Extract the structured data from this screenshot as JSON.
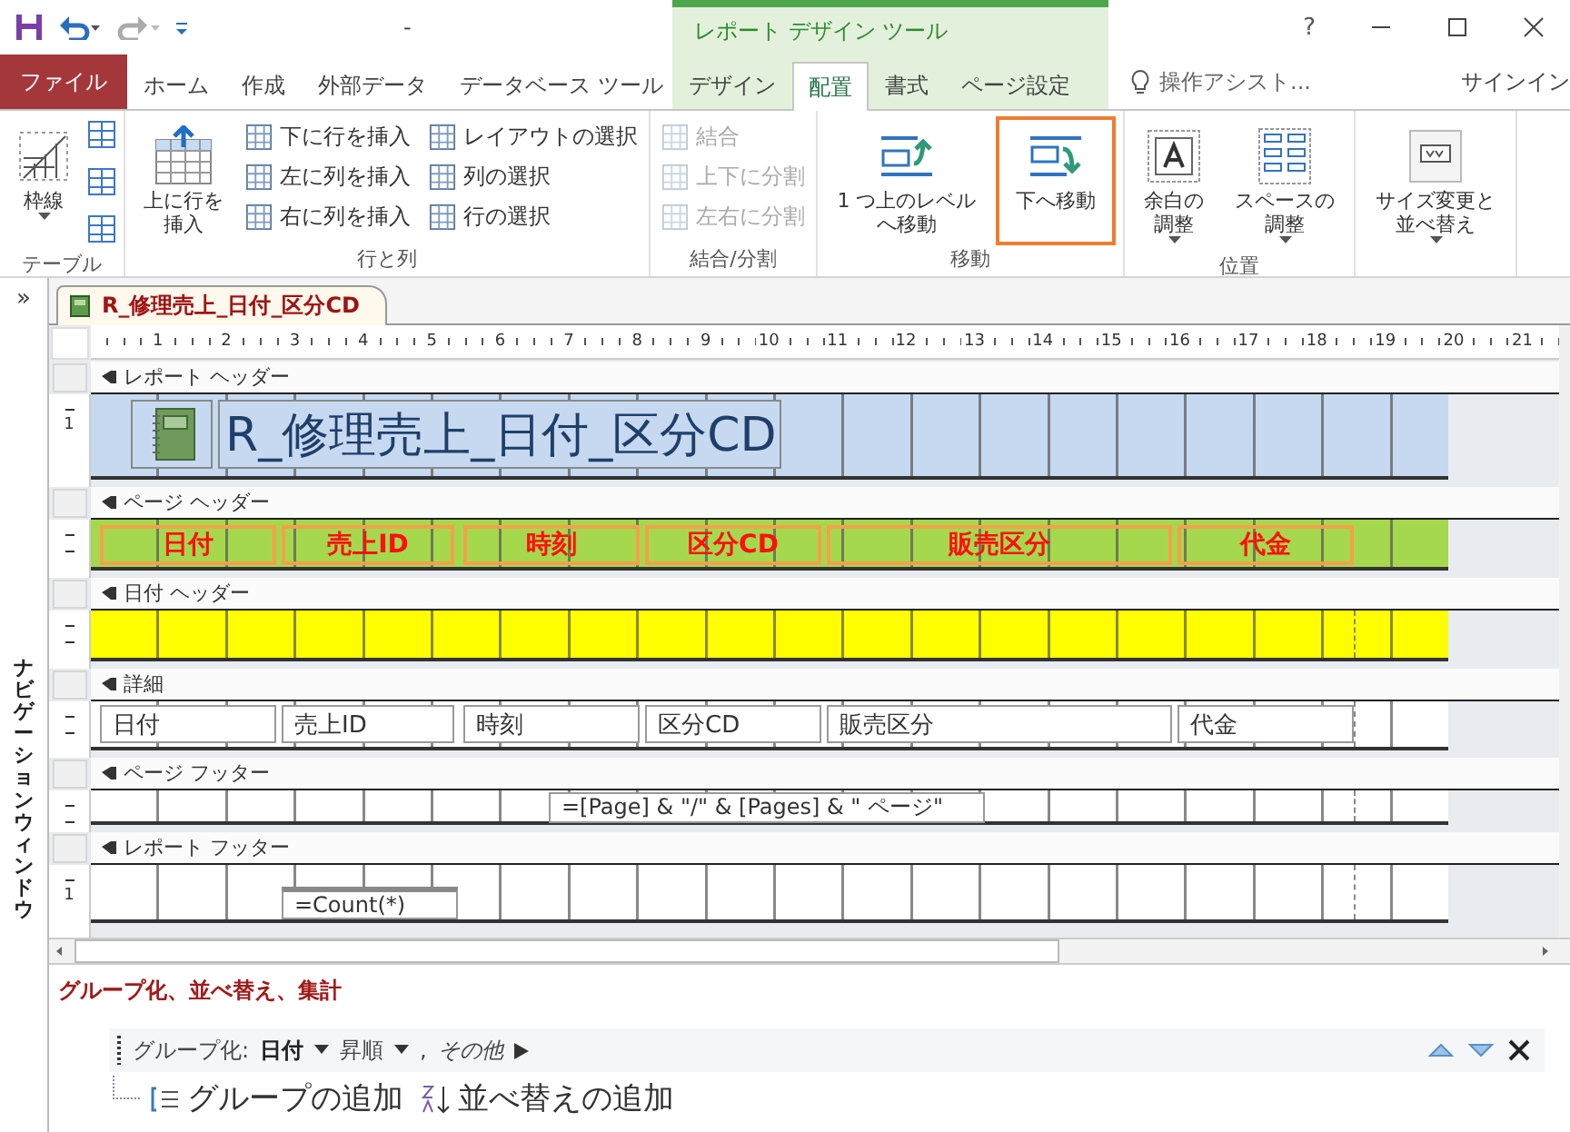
{
  "quick_access": {
    "title": "-"
  },
  "window": {
    "help": "?"
  },
  "context_title": "レポート デザイン ツール",
  "tabs": [
    {
      "label": "ファイル",
      "kind": "file",
      "contextual": false,
      "selected": false
    },
    {
      "label": "ホーム",
      "kind": "tab",
      "contextual": false,
      "selected": false
    },
    {
      "label": "作成",
      "kind": "tab",
      "contextual": false,
      "selected": false
    },
    {
      "label": "外部データ",
      "kind": "tab",
      "contextual": false,
      "selected": false
    },
    {
      "label": "データベース ツール",
      "kind": "tab",
      "contextual": false,
      "selected": false
    },
    {
      "label": "デザイン",
      "kind": "tab",
      "contextual": true,
      "selected": false
    },
    {
      "label": "配置",
      "kind": "tab",
      "contextual": true,
      "selected": true
    },
    {
      "label": "書式",
      "kind": "tab",
      "contextual": true,
      "selected": false
    },
    {
      "label": "ページ設定",
      "kind": "tab",
      "contextual": true,
      "selected": false
    }
  ],
  "tell_me": {
    "placeholder": "操作アシスト..."
  },
  "sign_in": "サインイン",
  "ribbon": {
    "groups": [
      {
        "label": "テーブル",
        "items": [
          {
            "kind": "large",
            "label": "枠線",
            "dropdown": true,
            "disabled": false,
            "highlighted": false
          },
          {
            "kind": "icon"
          },
          {
            "kind": "icon"
          },
          {
            "kind": "icon"
          }
        ]
      },
      {
        "label": "行と列",
        "items": [
          {
            "kind": "large",
            "label": "上に行を挿入",
            "dropdown": false,
            "disabled": false,
            "highlighted": false
          },
          {
            "kind": "small",
            "label": "下に行を挿入",
            "disabled": false
          },
          {
            "kind": "small",
            "label": "左に列を挿入",
            "disabled": false
          },
          {
            "kind": "small",
            "label": "右に列を挿入",
            "disabled": false
          },
          {
            "kind": "small",
            "label": "レイアウトの選択",
            "disabled": false
          },
          {
            "kind": "small",
            "label": "列の選択",
            "disabled": false
          },
          {
            "kind": "small",
            "label": "行の選択",
            "disabled": false
          }
        ]
      },
      {
        "label": "結合/分割",
        "items": [
          {
            "kind": "small",
            "label": "結合",
            "disabled": true
          },
          {
            "kind": "small",
            "label": "上下に分割",
            "disabled": true
          },
          {
            "kind": "small",
            "label": "左右に分割",
            "disabled": true
          }
        ]
      },
      {
        "label": "移動",
        "items": [
          {
            "kind": "large",
            "label": "1 つ上のレベルへ移動",
            "dropdown": false,
            "disabled": false,
            "highlighted": false
          },
          {
            "kind": "large",
            "label": "下へ移動",
            "dropdown": false,
            "disabled": false,
            "highlighted": true
          }
        ]
      },
      {
        "label": "位置",
        "items": [
          {
            "kind": "large",
            "label": "余白の調整",
            "dropdown": true,
            "disabled": false,
            "highlighted": false
          },
          {
            "kind": "large",
            "label": "スペースの調整",
            "dropdown": true,
            "disabled": false,
            "highlighted": false
          }
        ]
      },
      {
        "items": [
          {
            "kind": "large",
            "label": "サイズ変更と並べ替え",
            "dropdown": true,
            "disabled": false,
            "highlighted": false
          }
        ]
      }
    ]
  },
  "nav_pane": {
    "expand": "»",
    "title": "ナビゲーションウィンドウ"
  },
  "document_tab": {
    "title": "R_修理売上_日付_区分CD"
  },
  "ruler": [
    "1",
    "2",
    "3",
    "4",
    "5",
    "6",
    "7",
    "8",
    "9",
    "10",
    "11",
    "12",
    "13",
    "14",
    "15",
    "16",
    "17",
    "18",
    "19",
    "20",
    "21"
  ],
  "sections": [
    {
      "title": "レポート ヘッダー",
      "kind": "report-header",
      "color": "#c6d9f0",
      "ruler_label": "1",
      "controls": [
        {
          "kind": "logo"
        },
        {
          "kind": "title",
          "text": "R_修理売上_日付_区分CD"
        }
      ]
    },
    {
      "title": "ページ ヘッダー",
      "kind": "page-header",
      "color": "#a6d84e",
      "controls": [
        {
          "kind": "label",
          "text": "日付",
          "selected": true
        },
        {
          "kind": "label",
          "text": "売上ID",
          "selected": true
        },
        {
          "kind": "label",
          "text": "時刻",
          "selected": true
        },
        {
          "kind": "label",
          "text": "区分CD",
          "selected": true
        },
        {
          "kind": "label",
          "text": "販売区分",
          "selected": true
        },
        {
          "kind": "label",
          "text": "代金",
          "selected": true
        }
      ]
    },
    {
      "title": "日付 ヘッダー",
      "kind": "group-header",
      "color": "#ffff00"
    },
    {
      "title": "詳細",
      "kind": "detail",
      "color": "#ffffff",
      "controls": [
        {
          "kind": "textbox",
          "text": "日付"
        },
        {
          "kind": "textbox",
          "text": "売上ID"
        },
        {
          "kind": "textbox",
          "text": "時刻"
        },
        {
          "kind": "textbox",
          "text": "区分CD"
        },
        {
          "kind": "textbox",
          "text": "販売区分"
        },
        {
          "kind": "textbox",
          "text": "代金"
        }
      ]
    },
    {
      "title": "ページ フッター",
      "kind": "page-footer",
      "color": "#ffffff",
      "controls": [
        {
          "kind": "textbox",
          "text": "=[Page] & \"/\" & [Pages] & \" ページ\""
        }
      ]
    },
    {
      "title": "レポート フッター",
      "kind": "report-footer",
      "color": "#ffffff",
      "ruler_label": "1",
      "controls": [
        {
          "kind": "textbox",
          "text": "=Count(*)"
        }
      ]
    }
  ],
  "group_pane": {
    "title": "グループ化、並べ替え、集計",
    "group_row": {
      "label": "グループ化:",
      "field": "日付",
      "order": "昇順",
      "separator": ",",
      "more": "その他"
    },
    "add_group": "グループの追加",
    "add_sort": "並べ替えの追加"
  }
}
